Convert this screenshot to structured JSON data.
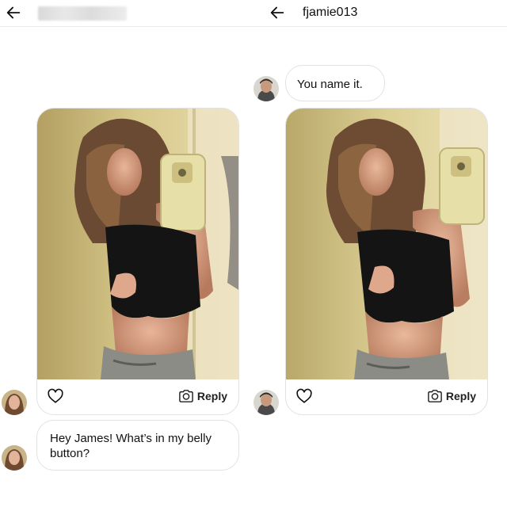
{
  "left_chat": {
    "header": {
      "contact_name": ""
    },
    "image_message": {
      "reply_label": "Reply"
    },
    "text_message": {
      "text": "Hey James! What’s in my belly button?"
    }
  },
  "right_chat": {
    "header": {
      "contact_name": "fjamie013"
    },
    "text_message": {
      "text": "You name it."
    },
    "image_message": {
      "reply_label": "Reply"
    }
  },
  "icons": {
    "back": "arrow-left-icon",
    "like": "heart-outline-icon",
    "reply": "camera-icon"
  },
  "colors": {
    "background": "#ffffff",
    "bubble_border": "#e2e2e2",
    "text": "#111111"
  }
}
